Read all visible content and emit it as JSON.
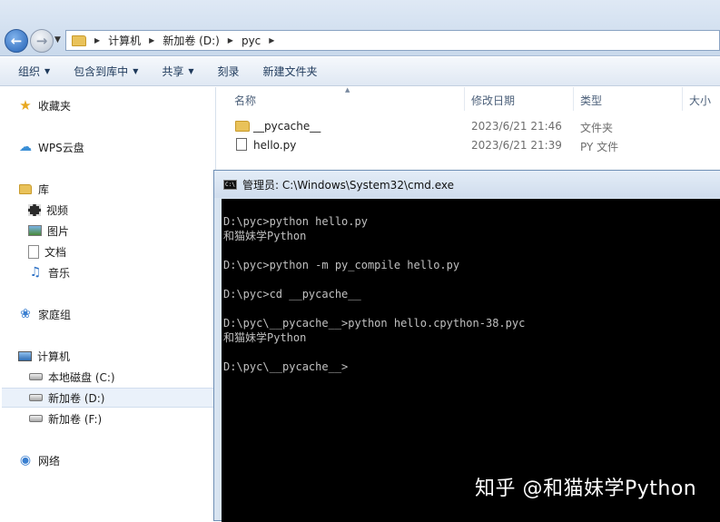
{
  "address_bar": {
    "breadcrumbs": [
      "计算机",
      "新加卷 (D:)",
      "pyc"
    ]
  },
  "toolbar": {
    "items": [
      {
        "label": "组织",
        "has_menu": true
      },
      {
        "label": "包含到库中",
        "has_menu": true
      },
      {
        "label": "共享",
        "has_menu": true
      },
      {
        "label": "刻录",
        "has_menu": false
      },
      {
        "label": "新建文件夹",
        "has_menu": false
      }
    ]
  },
  "navigation": {
    "favorites": "收藏夹",
    "wps": "WPS云盘",
    "libraries": "库",
    "library_items": [
      "视频",
      "图片",
      "文档",
      "音乐"
    ],
    "homegroup": "家庭组",
    "computer": "计算机",
    "drives": [
      "本地磁盘 (C:)",
      "新加卷 (D:)",
      "新加卷 (F:)"
    ],
    "selected_drive": "新加卷 (D:)",
    "network": "网络"
  },
  "file_list": {
    "columns": [
      "名称",
      "修改日期",
      "类型",
      "大小"
    ],
    "rows": [
      {
        "name": "__pycache__",
        "modified": "2023/6/21 21:46",
        "type": "文件夹",
        "icon": "folder-icon"
      },
      {
        "name": "hello.py",
        "modified": "2023/6/21 21:39",
        "type": "PY 文件",
        "icon": "python-file-icon"
      }
    ]
  },
  "cmd": {
    "title": "管理员: C:\\Windows\\System32\\cmd.exe",
    "icon_text": "C:\\",
    "lines": [
      "D:\\pyc>python hello.py",
      "和猫妹学Python",
      "",
      "D:\\pyc>python -m py_compile hello.py",
      "",
      "D:\\pyc>cd __pycache__",
      "",
      "D:\\pyc\\__pycache__>python hello.cpython-38.pyc",
      "和猫妹学Python",
      "",
      "D:\\pyc\\__pycache__>"
    ]
  },
  "watermark": "知乎 @和猫妹学Python"
}
